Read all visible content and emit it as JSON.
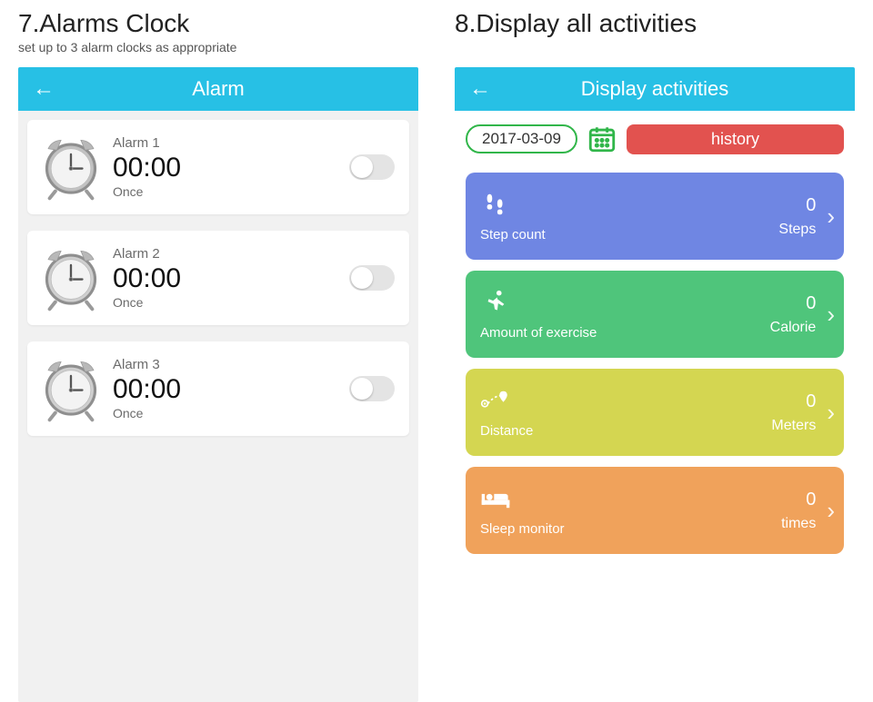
{
  "left": {
    "heading": "7.Alarms Clock",
    "sub": "set up to 3 alarm clocks as appropriate",
    "topbar": "Alarm",
    "alarms": [
      {
        "name": "Alarm 1",
        "time": "00:00",
        "repeat": "Once"
      },
      {
        "name": "Alarm 2",
        "time": "00:00",
        "repeat": "Once"
      },
      {
        "name": "Alarm 3",
        "time": "00:00",
        "repeat": "Once"
      }
    ]
  },
  "right": {
    "heading": "8.Display all activities",
    "sub": "",
    "topbar": "Display activities",
    "date": "2017-03-09",
    "history": "history",
    "activities": [
      {
        "label": "Step count",
        "value": "0",
        "unit": "Steps",
        "color": "c-step"
      },
      {
        "label": "Amount of exercise",
        "value": "0",
        "unit": "Calorie",
        "color": "c-ex"
      },
      {
        "label": "Distance",
        "value": "0",
        "unit": "Meters",
        "color": "c-dist"
      },
      {
        "label": "Sleep monitor",
        "value": "0",
        "unit": "times",
        "color": "c-sleep"
      }
    ]
  }
}
